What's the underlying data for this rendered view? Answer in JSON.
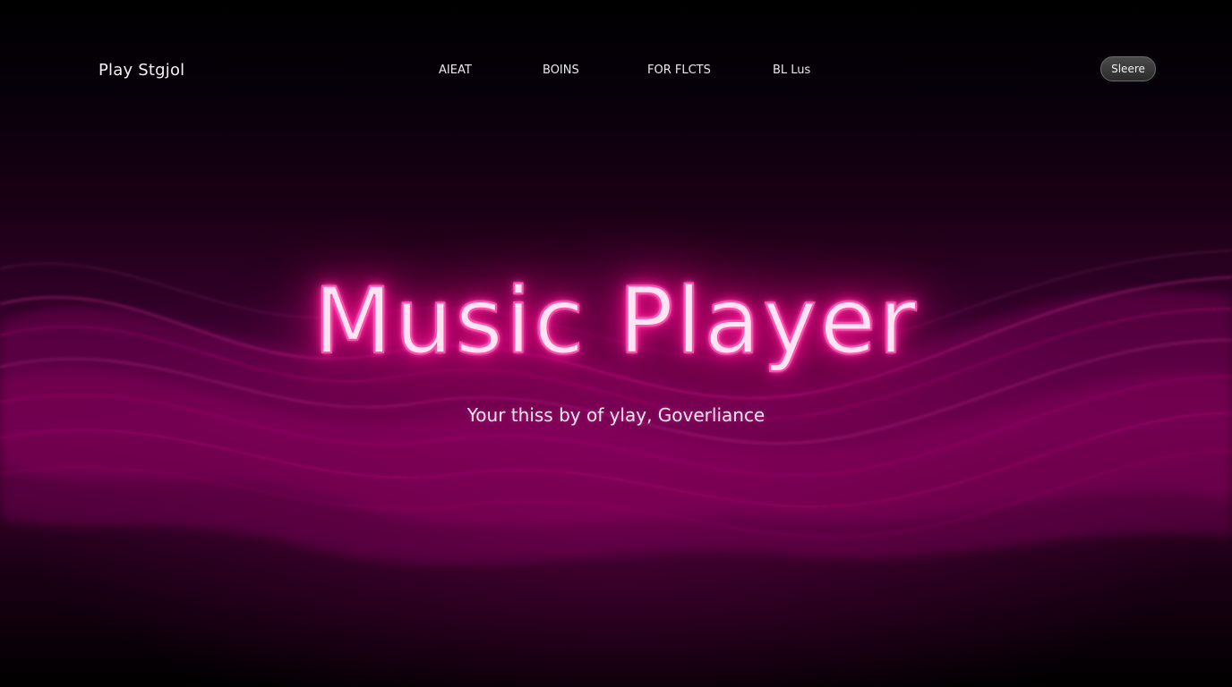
{
  "navbar": {
    "brand": "Play Stgjol",
    "links": [
      "AIEAT",
      "BOINS",
      "FOR FLCTS",
      "BL Lus"
    ],
    "button_label": "Sleere"
  },
  "hero": {
    "title": "Music Player",
    "subtitle": "Your thiss by of ylay, Goverliance"
  },
  "colors": {
    "background": "#000000",
    "accent": "#ff1a9a",
    "wave": "#c4007e"
  }
}
